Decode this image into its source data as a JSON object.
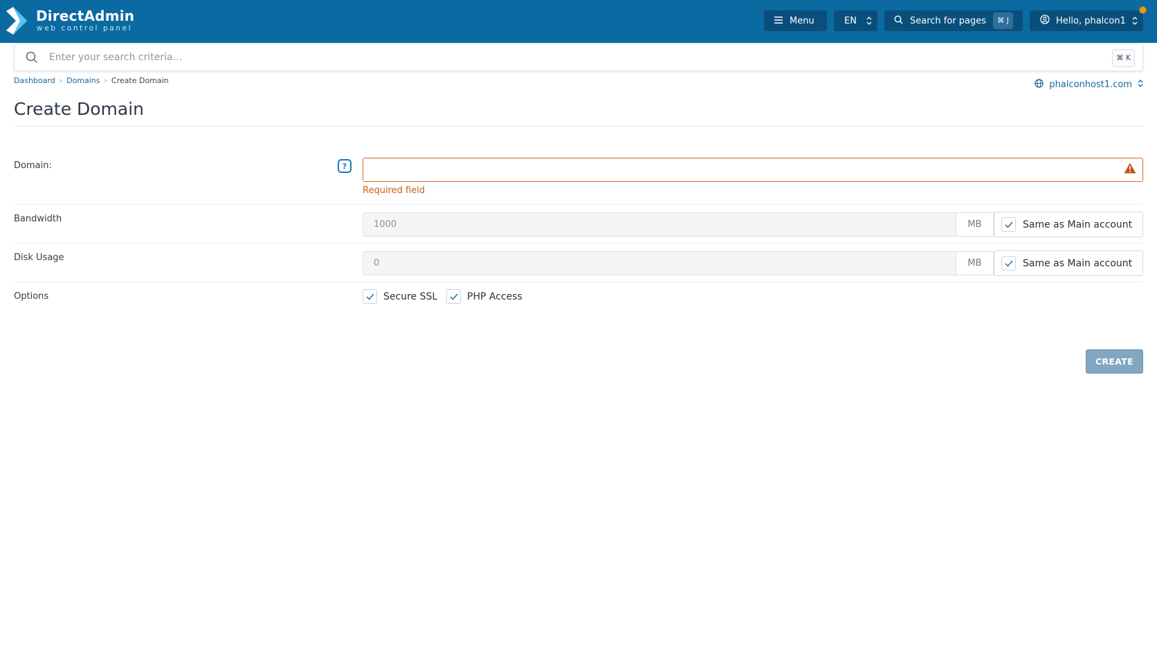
{
  "colors": {
    "topbar": "#0b6aa2",
    "topbar_button": "#0a4f7c",
    "link": "#1566a0",
    "error": "#c8601a",
    "create_button": "#82a7c0"
  },
  "brand": {
    "title": "DirectAdmin",
    "subtitle": "web control panel",
    "icon": "directadmin-chevron-logo"
  },
  "topbar": {
    "menu_label": "Menu",
    "menu_icon": "hamburger-icon",
    "language": "EN",
    "search_label": "Search for pages",
    "search_shortcut": "⌘ J",
    "user_greeting": "Hello, phalcon1"
  },
  "criteria": {
    "placeholder": "Enter your search criteria...",
    "shortcut": "⌘ K"
  },
  "breadcrumb": {
    "items": [
      "Dashboard",
      "Domains"
    ],
    "current": "Create Domain"
  },
  "domain_switcher": {
    "value": "phalconhost1.com"
  },
  "page": {
    "title": "Create Domain"
  },
  "form": {
    "domain": {
      "label": "Domain:",
      "value": "",
      "help": "?",
      "error": "Required field"
    },
    "bandwidth": {
      "label": "Bandwidth",
      "value": "1000",
      "unit": "MB",
      "same_label": "Same as Main account",
      "same_checked": true
    },
    "disk_usage": {
      "label": "Disk Usage",
      "value": "0",
      "unit": "MB",
      "same_label": "Same as Main account",
      "same_checked": true
    },
    "options": {
      "label": "Options",
      "secure_ssl_label": "Secure SSL",
      "secure_ssl_checked": true,
      "php_access_label": "PHP Access",
      "php_access_checked": true
    },
    "submit_label": "CREATE"
  }
}
